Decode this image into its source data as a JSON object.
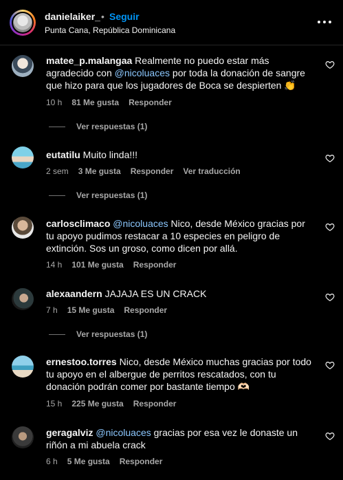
{
  "header": {
    "username": "danielaiker_",
    "dot": "•",
    "follow_label": "Seguir",
    "location": "Punta Cana, República Dominicana"
  },
  "comments": [
    {
      "username": "matee_p.malangaa",
      "text_before": " Realmente no puedo estar más agradecido con ",
      "mention": "@nicoluaces",
      "text_after": " por toda la donación de sangre que hizo para que los jugadores de Boca se despierten 👏",
      "time": "10 h",
      "likes": "81 Me gusta",
      "reply": "Responder",
      "replies": "Ver respuestas (1)"
    },
    {
      "username": "eutatilu",
      "text": " Muito linda!!!",
      "time": "2 sem",
      "likes": "3 Me gusta",
      "reply": "Responder",
      "translate": "Ver traducción",
      "replies": "Ver respuestas (1)"
    },
    {
      "username": "carlosclimaco",
      "mention": "@nicoluaces",
      "text_after": " Nico, desde México gracias por tu apoyo pudimos restacar a 10 especies en peligro de extinción. Sos un groso, como dicen por allá.",
      "time": "14 h",
      "likes": "101 Me gusta",
      "reply": "Responder"
    },
    {
      "username": "alexaandern",
      "text": " JAJAJA ES UN CRACK",
      "time": "7 h",
      "likes": "15 Me gusta",
      "reply": "Responder",
      "replies": "Ver respuestas (1)"
    },
    {
      "username": "ernestoo.torres",
      "text": " Nico, desde México muchas gracias por todo tu apoyo en el albergue de perritos rescatados, con tu donación podrán comer por bastante tiempo 🫶🏻",
      "time": "15 h",
      "likes": "225 Me gusta",
      "reply": "Responder"
    },
    {
      "username": "geragalviz",
      "mention": "@nicoluaces",
      "text_after": " gracias por esa vez le donaste un riñón a mi abuela crack",
      "time": "6 h",
      "likes": "5 Me gusta",
      "reply": "Responder"
    }
  ],
  "colors": {
    "background": "#000000",
    "text": "#f5f5f5",
    "muted": "#a8a8a8",
    "link": "#0095f6",
    "mention": "#8cc8ff"
  },
  "icons": {
    "more": "more-options-icon",
    "like": "heart-icon"
  }
}
